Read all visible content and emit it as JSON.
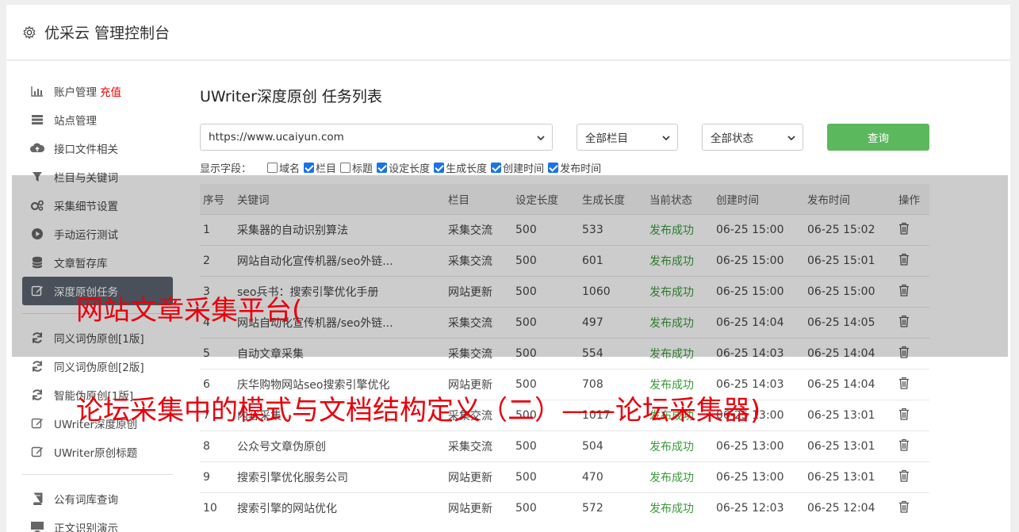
{
  "header": {
    "title": "优采云 管理控制台"
  },
  "sidebar": {
    "group1": [
      {
        "label": "账户管理",
        "badge": "充值",
        "icon": "bar-chart-icon"
      },
      {
        "label": "站点管理",
        "icon": "server-icon"
      },
      {
        "label": "接口文件相关",
        "icon": "cloud-upload-icon"
      },
      {
        "label": "栏目与关键词",
        "icon": "filter-icon"
      },
      {
        "label": "采集细节设置",
        "icon": "cogs-icon"
      },
      {
        "label": "手动运行测试",
        "icon": "play-icon"
      },
      {
        "label": "文章暂存库",
        "icon": "database-icon"
      },
      {
        "label": "深度原创任务",
        "icon": "edit-icon",
        "active": true
      }
    ],
    "group2": [
      {
        "label": "同义词伪原创[1版]",
        "icon": "refresh-icon"
      },
      {
        "label": "同义词伪原创[2版]",
        "icon": "refresh-icon"
      },
      {
        "label": "智能伪原创[1版]",
        "icon": "refresh-icon"
      },
      {
        "label": "UWriter深度原创",
        "icon": "edit-icon"
      },
      {
        "label": "UWriter原创标题",
        "icon": "edit-icon"
      }
    ],
    "group3": [
      {
        "label": "公有词库查询",
        "icon": "book-icon"
      },
      {
        "label": "正文识别演示",
        "icon": "monitor-icon"
      }
    ]
  },
  "page": {
    "title": "UWriter深度原创 任务列表"
  },
  "filters": {
    "site": "https://www.ucaiyun.com",
    "column": "全部栏目",
    "status": "全部状态",
    "query_label": "查询"
  },
  "fields": {
    "label": "显示字段：",
    "items": [
      {
        "label": "域名",
        "checked": false
      },
      {
        "label": "栏目",
        "checked": true
      },
      {
        "label": "标题",
        "checked": false
      },
      {
        "label": "设定长度",
        "checked": true
      },
      {
        "label": "生成长度",
        "checked": true
      },
      {
        "label": "创建时间",
        "checked": true
      },
      {
        "label": "发布时间",
        "checked": true
      }
    ]
  },
  "table": {
    "headers": [
      "序号",
      "关键词",
      "栏目",
      "设定长度",
      "生成长度",
      "当前状态",
      "创建时间",
      "发布时间",
      "操作"
    ],
    "rows": [
      [
        "1",
        "采集器的自动识别算法",
        "采集交流",
        "500",
        "533",
        "发布成功",
        "06-25 15:00",
        "06-25 15:02"
      ],
      [
        "2",
        "网站自动化宣传机器/seo外链...",
        "采集交流",
        "500",
        "601",
        "发布成功",
        "06-25 15:00",
        "06-25 15:01"
      ],
      [
        "3",
        "seo兵书：搜索引擎优化手册",
        "网站更新",
        "500",
        "1060",
        "发布成功",
        "06-25 15:00",
        "06-25 15:00"
      ],
      [
        "4",
        "网站自动化宣传机器/seo外链...",
        "采集交流",
        "500",
        "497",
        "发布成功",
        "06-25 14:04",
        "06-25 14:05"
      ],
      [
        "5",
        "自动文章采集",
        "采集交流",
        "500",
        "554",
        "发布成功",
        "06-25 14:03",
        "06-25 14:04"
      ],
      [
        "6",
        "庆华购物网站seo搜索引擎优化",
        "网站更新",
        "500",
        "708",
        "发布成功",
        "06-25 14:03",
        "06-25 14:04"
      ],
      [
        "7",
        "内容采集",
        "采集交流",
        "500",
        "1017",
        "发布成功",
        "06-25 13:00",
        "06-25 13:01"
      ],
      [
        "8",
        "公众号文章伪原创",
        "采集交流",
        "500",
        "504",
        "发布成功",
        "06-25 13:00",
        "06-25 13:01"
      ],
      [
        "9",
        "搜索引擎优化服务公司",
        "网站更新",
        "500",
        "470",
        "发布成功",
        "06-25 13:00",
        "06-25 13:01"
      ],
      [
        "10",
        "搜索引擎的网站优化",
        "网站更新",
        "500",
        "572",
        "发布成功",
        "06-25 12:03",
        "06-25 12:04"
      ]
    ]
  },
  "overlay": {
    "line1": "网站文章采集平台(",
    "line2": "论坛采集中的模式与文档结构定义（二）——论坛采集器)"
  },
  "colors": {
    "accent_green": "#5cb85c",
    "active_bg": "#5c6470",
    "overlay_text": "#e8000b"
  }
}
